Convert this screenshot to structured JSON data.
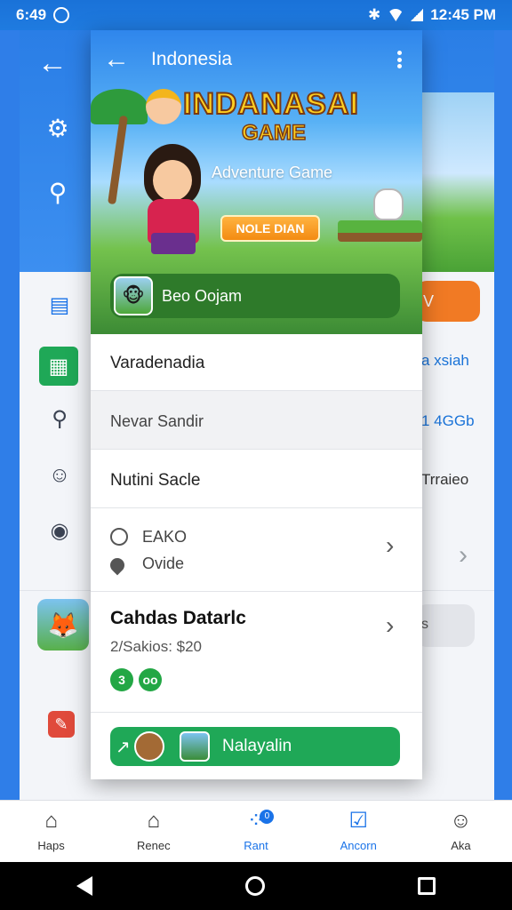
{
  "status_bar": {
    "time": "6:49",
    "right_text": "12:45 PM"
  },
  "background_app": {
    "right_texts": [
      "V",
      "a xsiah",
      "1 4GGb",
      "Trraieo",
      "s"
    ]
  },
  "card": {
    "title": "Indonesia",
    "banner": {
      "game_title": "INDANASAI",
      "game_subtitle": "GAME",
      "subtitle": "Adventure Game",
      "cta": "NOLE DIAN",
      "player_name": "Beo Oojam"
    },
    "rows": [
      {
        "label": "Varadenadia"
      },
      {
        "label": "Nevar Sandir"
      },
      {
        "label": "Nutini Sacle"
      }
    ],
    "info": {
      "line1": "EAKO",
      "line2": "Ovide"
    },
    "details": {
      "title": "Cahdas Datarlc",
      "meta": "2/Sakios: $20",
      "badge1": "3",
      "badge2": "oo"
    },
    "action": {
      "label": "Nalayalin"
    }
  },
  "bottom_nav": [
    {
      "label": "Haps",
      "icon": "home-icon"
    },
    {
      "label": "Renec",
      "icon": "store-icon"
    },
    {
      "label": "Rant",
      "icon": "games-icon",
      "badge": "0"
    },
    {
      "label": "Ancorn",
      "icon": "inbox-icon"
    },
    {
      "label": "Aka",
      "icon": "account-icon"
    }
  ],
  "colors": {
    "primary": "#2a7ee6",
    "green": "#1fa857",
    "orange": "#f17a24"
  }
}
